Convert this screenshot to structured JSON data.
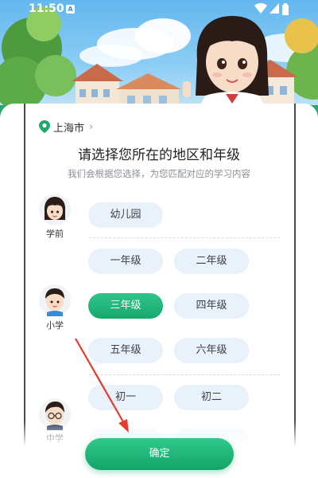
{
  "status_bar": {
    "time": "11:50",
    "notification_icon": "A"
  },
  "location": {
    "city": "上海市",
    "icon": "location-pin-icon",
    "chevron": "›"
  },
  "page": {
    "title": "请选择您所在的地区和年级",
    "subtitle": "我们会根据您选择，为您匹配对应的学习内容"
  },
  "sections": [
    {
      "label": "学前",
      "avatar": "girl-avatar-icon",
      "grades": [
        "幼儿园"
      ]
    },
    {
      "label": "小学",
      "avatar": "boy-avatar-icon",
      "grades": [
        "一年级",
        "二年级",
        "三年级",
        "四年级",
        "五年级",
        "六年级"
      ]
    },
    {
      "label": "中学",
      "avatar": "boy-glasses-avatar-icon",
      "grades": [
        "初一",
        "初二"
      ]
    }
  ],
  "selected_grade": "三年级",
  "confirm_label": "确定",
  "colors": {
    "accent": "#17a86d",
    "chip_bg": "#e9f1fb",
    "annotation": "#e23c2f"
  }
}
